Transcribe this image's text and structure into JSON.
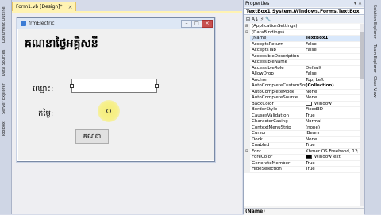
{
  "left_strip": {
    "tabs": [
      "Document Outline",
      "Data Sources",
      "Server Explorer",
      "Toolbox"
    ]
  },
  "document_tab": {
    "title": "Form1.vb [Design]*",
    "close_glyph": "×"
  },
  "form": {
    "title": "frmElectric",
    "caption_buttons": [
      "–",
      "□",
      "×"
    ],
    "heading": "គណនាថ្លៃអគ្គិសនី",
    "name_label": "ឈ្មោះ:",
    "name_value": "",
    "price_label": "តម្លៃ:",
    "price_value": "",
    "calculate_button": "គណនា"
  },
  "properties": {
    "title": "Properties",
    "title_icons": "▾ ✕",
    "selector": "TextBox1  System.Windows.Forms.TextBox",
    "toolbar": "⊞  A↓  ⚡  🔧",
    "rows": [
      {
        "gutter": "⊞",
        "name": "(ApplicationSettings)",
        "value": ""
      },
      {
        "gutter": "⊞",
        "name": "(DataBindings)",
        "value": ""
      },
      {
        "gutter": "",
        "name": "(Name)",
        "value": "TextBox1",
        "bold": true,
        "selected": true
      },
      {
        "gutter": "",
        "name": "AcceptsReturn",
        "value": "False"
      },
      {
        "gutter": "",
        "name": "AcceptsTab",
        "value": "False"
      },
      {
        "gutter": "",
        "name": "AccessibleDescription",
        "value": ""
      },
      {
        "gutter": "",
        "name": "AccessibleName",
        "value": ""
      },
      {
        "gutter": "",
        "name": "AccessibleRole",
        "value": "Default"
      },
      {
        "gutter": "",
        "name": "AllowDrop",
        "value": "False"
      },
      {
        "gutter": "",
        "name": "Anchor",
        "value": "Top, Left"
      },
      {
        "gutter": "",
        "name": "AutoCompleteCustomSour",
        "value": "(Collection)",
        "bold": true
      },
      {
        "gutter": "",
        "name": "AutoCompleteMode",
        "value": "None"
      },
      {
        "gutter": "",
        "name": "AutoCompleteSource",
        "value": "None"
      },
      {
        "gutter": "",
        "name": "BackColor",
        "value": "Window",
        "swatch": "#ffffff"
      },
      {
        "gutter": "",
        "name": "BorderStyle",
        "value": "Fixed3D"
      },
      {
        "gutter": "",
        "name": "CausesValidation",
        "value": "True"
      },
      {
        "gutter": "",
        "name": "CharacterCasing",
        "value": "Normal"
      },
      {
        "gutter": "",
        "name": "ContextMenuStrip",
        "value": "(none)"
      },
      {
        "gutter": "",
        "name": "Cursor",
        "value": "IBeam"
      },
      {
        "gutter": "",
        "name": "Dock",
        "value": "None"
      },
      {
        "gutter": "",
        "name": "Enabled",
        "value": "True"
      },
      {
        "gutter": "⊞",
        "name": "Font",
        "value": "Khmer OS Freehand, 12pt"
      },
      {
        "gutter": "",
        "name": "ForeColor",
        "value": "WindowText",
        "swatch": "#000000"
      },
      {
        "gutter": "",
        "name": "GenerateMember",
        "value": "True"
      },
      {
        "gutter": "",
        "name": "HideSelection",
        "value": "True"
      }
    ],
    "description_title": "(Name)"
  },
  "right_strip": {
    "tabs": [
      "Solution Explorer",
      "Team Explorer",
      "Class View"
    ]
  }
}
